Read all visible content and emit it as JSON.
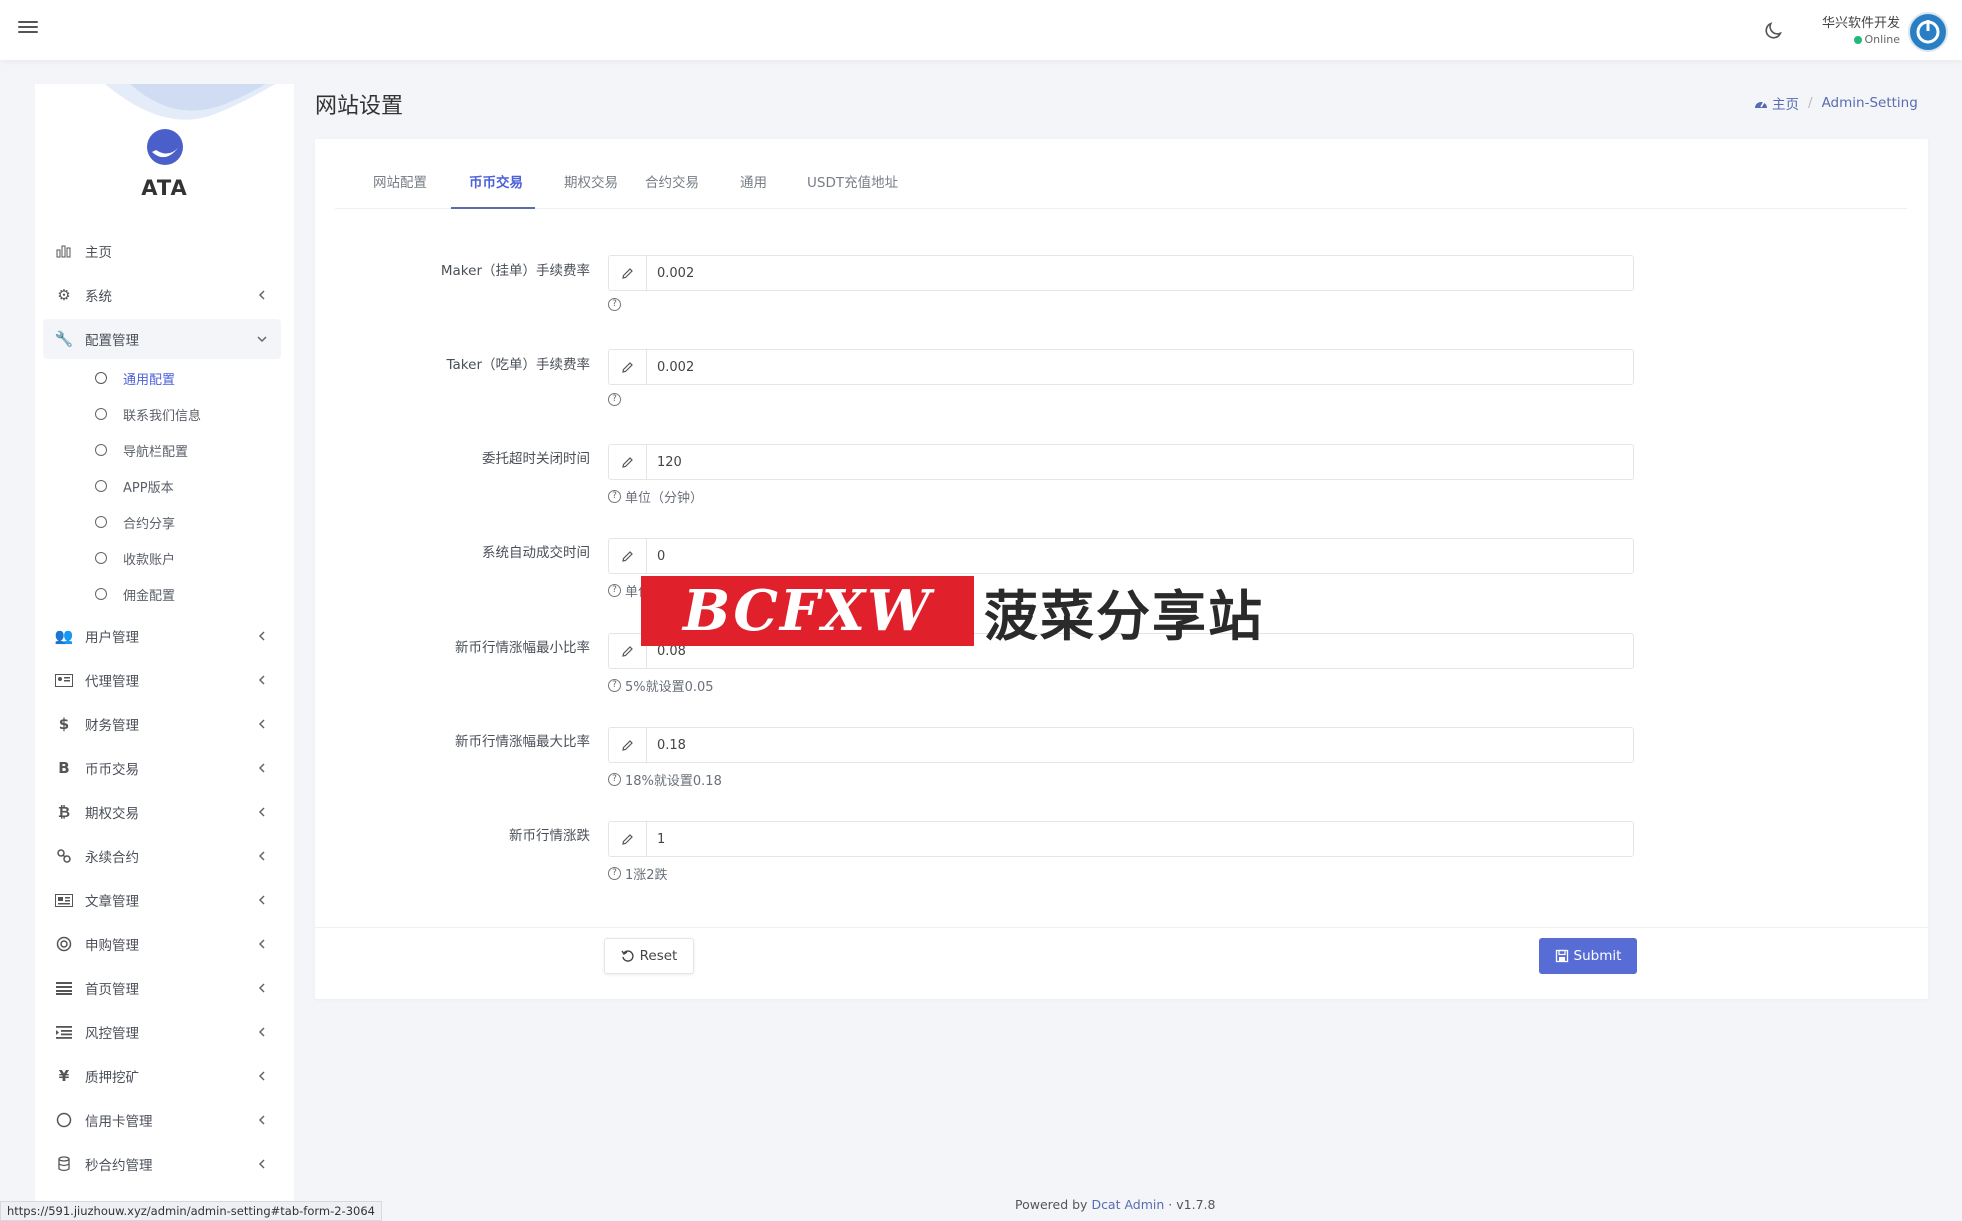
{
  "navbar": {
    "user_name": "华兴软件开发",
    "user_status": "Online"
  },
  "sidebar": {
    "brand": "ATA",
    "items": [
      {
        "label": "主页",
        "icon": "bar-chart-icon"
      },
      {
        "label": "系统",
        "icon": "gear-icon"
      },
      {
        "label": "配置管理",
        "icon": "wrench-icon"
      },
      {
        "label": "用户管理",
        "icon": "users-icon"
      },
      {
        "label": "代理管理",
        "icon": "id-card-icon"
      },
      {
        "label": "财务管理",
        "icon": "dollar-icon"
      },
      {
        "label": "币币交易",
        "icon": "bitcoin-letter-icon"
      },
      {
        "label": "期权交易",
        "icon": "bitcoin-icon"
      },
      {
        "label": "永续合约",
        "icon": "link-icon"
      },
      {
        "label": "文章管理",
        "icon": "newspaper-icon"
      },
      {
        "label": "申购管理",
        "icon": "globe-icon"
      },
      {
        "label": "首页管理",
        "icon": "list-icon"
      },
      {
        "label": "风控管理",
        "icon": "indent-icon"
      },
      {
        "label": "质押挖矿",
        "icon": "yen-icon"
      },
      {
        "label": "信用卡管理",
        "icon": "circle-icon"
      },
      {
        "label": "秒合约管理",
        "icon": "coins-icon"
      }
    ],
    "sub_items": [
      "通用配置",
      "联系我们信息",
      "导航栏配置",
      "APP版本",
      "合约分享",
      "收款账户",
      "佣金配置"
    ]
  },
  "page": {
    "title": "网站设置",
    "breadcrumb_home": "主页",
    "breadcrumb_sep": "/",
    "breadcrumb_current": "Admin-Setting"
  },
  "tabs": [
    "网站配置",
    "币币交易",
    "期权交易",
    "合约交易",
    "通用",
    "USDT充值地址"
  ],
  "form": {
    "fields": [
      {
        "label": "Maker（挂单）手续费率",
        "value": "0.002",
        "help": ""
      },
      {
        "label": "Taker（吃单）手续费率",
        "value": "0.002",
        "help": ""
      },
      {
        "label": "委托超时关闭时间",
        "value": "120",
        "help": "单位（分钟）"
      },
      {
        "label": "系统自动成交时间",
        "value": "0",
        "help": "单位（分钟）"
      },
      {
        "label": "新币行情涨幅最小比率",
        "value": "0.08",
        "help": "5%就设置0.05"
      },
      {
        "label": "新币行情涨幅最大比率",
        "value": "0.18",
        "help": "18%就设置0.18"
      },
      {
        "label": "新币行情涨跌",
        "value": "1",
        "help": "1涨2跌"
      }
    ],
    "reset_label": "Reset",
    "submit_label": "Submit"
  },
  "watermark": {
    "logo_text": "BCFXW",
    "text": "菠菜分享站"
  },
  "footer": {
    "powered_by": "Powered by",
    "product": "Dcat Admin",
    "separator": "·",
    "version": "v1.7.8"
  },
  "status_url": "https://591.jiuzhouw.xyz/admin/admin-setting#tab-form-2-3064",
  "colors": {
    "accent": "#586cd6",
    "active_text": "#4c60da",
    "online": "#21b978"
  }
}
